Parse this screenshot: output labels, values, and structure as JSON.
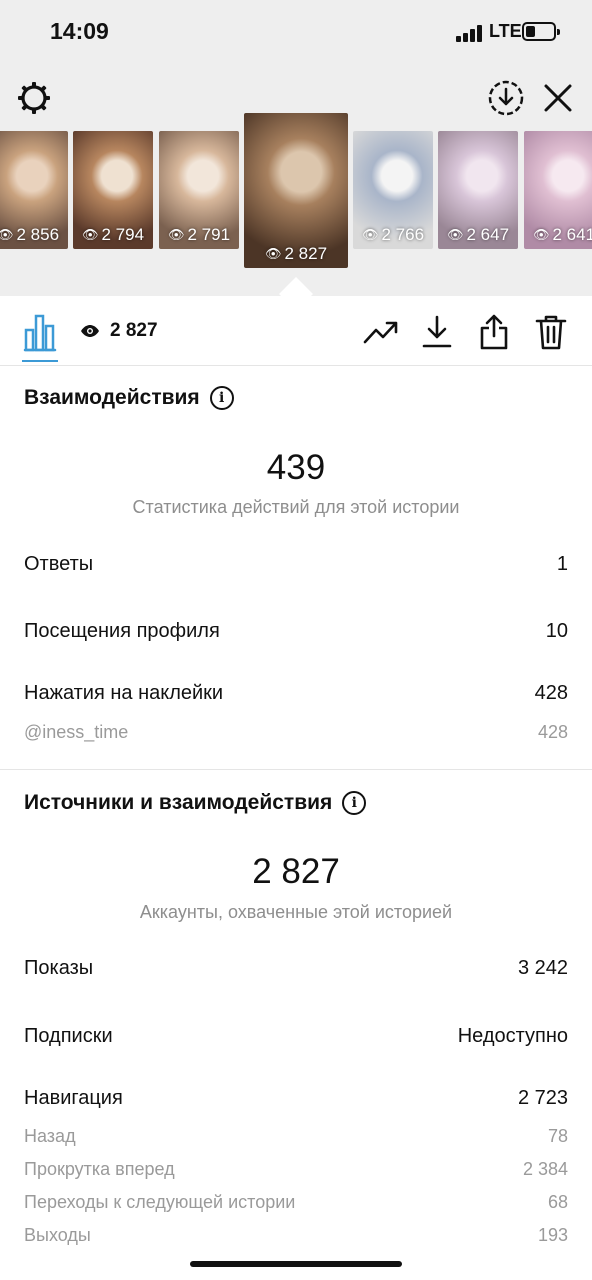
{
  "status_bar": {
    "time": "14:09",
    "network": "LTE"
  },
  "stories": [
    {
      "views": "2 856",
      "colors": [
        "#6b5143",
        "#c9a27e",
        "#e9d2bd"
      ]
    },
    {
      "views": "2 794",
      "colors": [
        "#5b3a2b",
        "#b7865f",
        "#efe1d1"
      ]
    },
    {
      "views": "2 791",
      "colors": [
        "#7b6150",
        "#d7b79b",
        "#f2e6da"
      ]
    },
    {
      "views": "2 827",
      "colors": [
        "#4c3526",
        "#a7805e",
        "#dcc6ad"
      ]
    },
    {
      "views": "2 766",
      "colors": [
        "#d9d9d9",
        "#a9b5c9",
        "#f4f4f4"
      ]
    },
    {
      "views": "2 647",
      "colors": [
        "#9a8796",
        "#d8c5d8",
        "#f1e6ef"
      ]
    },
    {
      "views": "2 641",
      "colors": [
        "#b08ba6",
        "#e0bfd2",
        "#f6e9f0"
      ]
    }
  ],
  "toolbar": {
    "total_views": "2 827"
  },
  "interactions": {
    "title": "Взаимодействия",
    "total": "439",
    "subtitle": "Статистика действий для этой истории",
    "rows": [
      {
        "label": "Ответы",
        "value": "1"
      },
      {
        "label": "Посещения профиля",
        "value": "10"
      },
      {
        "label": "Нажатия на наклейки",
        "value": "428"
      }
    ],
    "sticker_row": {
      "label": "@iness_time",
      "value": "428"
    }
  },
  "discovery": {
    "title": "Источники и взаимодействия",
    "total": "2 827",
    "subtitle": "Аккаунты, охваченные этой историей",
    "rows": [
      {
        "label": "Показы",
        "value": "3 242"
      },
      {
        "label": "Подписки",
        "value": "Недоступно"
      },
      {
        "label": "Навигация",
        "value": "2 723"
      }
    ],
    "nav_rows": [
      {
        "label": "Назад",
        "value": "78"
      },
      {
        "label": "Прокрутка вперед",
        "value": "2 384"
      },
      {
        "label": "Переходы к следующей истории",
        "value": "68"
      },
      {
        "label": "Выходы",
        "value": "193"
      }
    ]
  },
  "colors": {
    "accent": "#3c9ad6",
    "muted": "#8e8e8e"
  }
}
